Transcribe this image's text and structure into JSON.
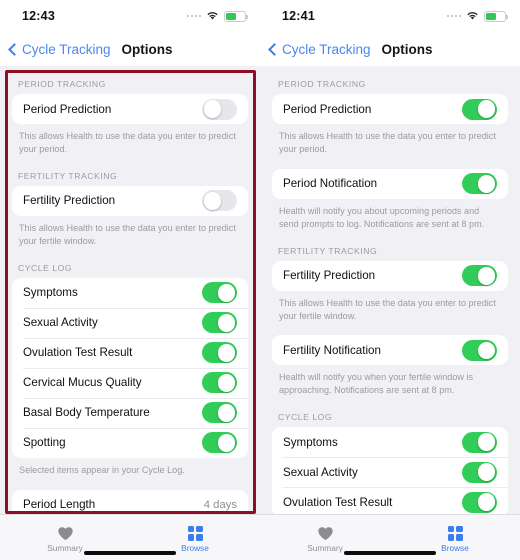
{
  "app": {
    "accent_blue": "#3a7dec",
    "toggle_on_green": "#32cd58",
    "highlight_red": "#8c0f26"
  },
  "panels": [
    {
      "status": {
        "time": "12:43",
        "wifi_icon": "wifi-icon",
        "battery_icon": "battery-icon",
        "signal_icon": "signal-dots-icon"
      },
      "nav": {
        "back_label": "Cycle Tracking",
        "back_icon": "chevron-left-icon",
        "title": "Options"
      },
      "highlighted": true,
      "sections": [
        {
          "header": "PERIOD TRACKING",
          "rows": [
            {
              "label": "Period Prediction",
              "toggle": "off"
            }
          ],
          "footnote": "This allows Health to use the data you enter to predict your period."
        },
        {
          "header": "FERTILITY TRACKING",
          "rows": [
            {
              "label": "Fertility Prediction",
              "toggle": "off"
            }
          ],
          "footnote": "This allows Health to use the data you enter to predict your fertile window."
        },
        {
          "header": "CYCLE LOG",
          "rows": [
            {
              "label": "Symptoms",
              "toggle": "on"
            },
            {
              "label": "Sexual Activity",
              "toggle": "on"
            },
            {
              "label": "Ovulation Test Result",
              "toggle": "on"
            },
            {
              "label": "Cervical Mucus Quality",
              "toggle": "on"
            },
            {
              "label": "Basal Body Temperature",
              "toggle": "on"
            },
            {
              "label": "Spotting",
              "toggle": "on"
            }
          ],
          "footnote": "Selected items appear in your Cycle Log."
        },
        {
          "header": "",
          "rows": [
            {
              "label": "Period Length",
              "value": "4 days"
            }
          ],
          "footnote": ""
        }
      ],
      "tabs": [
        {
          "label": "Summary",
          "icon": "heart-icon",
          "active": false
        },
        {
          "label": "Browse",
          "icon": "grid-icon",
          "active": true
        }
      ]
    },
    {
      "status": {
        "time": "12:41",
        "wifi_icon": "wifi-icon",
        "battery_icon": "battery-icon",
        "signal_icon": "signal-dots-icon"
      },
      "nav": {
        "back_label": "Cycle Tracking",
        "back_icon": "chevron-left-icon",
        "title": "Options"
      },
      "highlighted": false,
      "sections": [
        {
          "header": "PERIOD TRACKING",
          "rows": [
            {
              "label": "Period Prediction",
              "toggle": "on"
            }
          ],
          "footnote": "This allows Health to use the data you enter to predict your period."
        },
        {
          "header": "",
          "rows": [
            {
              "label": "Period Notification",
              "toggle": "on"
            }
          ],
          "footnote": "Health will notify you about upcoming periods and send prompts to log. Notifications are sent at 8 pm."
        },
        {
          "header": "FERTILITY TRACKING",
          "rows": [
            {
              "label": "Fertility Prediction",
              "toggle": "on"
            }
          ],
          "footnote": "This allows Health to use the data you enter to predict your fertile window."
        },
        {
          "header": "",
          "rows": [
            {
              "label": "Fertility Notification",
              "toggle": "on"
            }
          ],
          "footnote": "Health will notify you when your fertile window is approaching. Notifications are sent at 8 pm."
        },
        {
          "header": "CYCLE LOG",
          "rows": [
            {
              "label": "Symptoms",
              "toggle": "on"
            },
            {
              "label": "Sexual Activity",
              "toggle": "on"
            },
            {
              "label": "Ovulation Test Result",
              "toggle": "on"
            }
          ],
          "footnote": ""
        }
      ],
      "tabs": [
        {
          "label": "Summary",
          "icon": "heart-icon",
          "active": false
        },
        {
          "label": "Browse",
          "icon": "grid-icon",
          "active": true
        }
      ]
    }
  ]
}
